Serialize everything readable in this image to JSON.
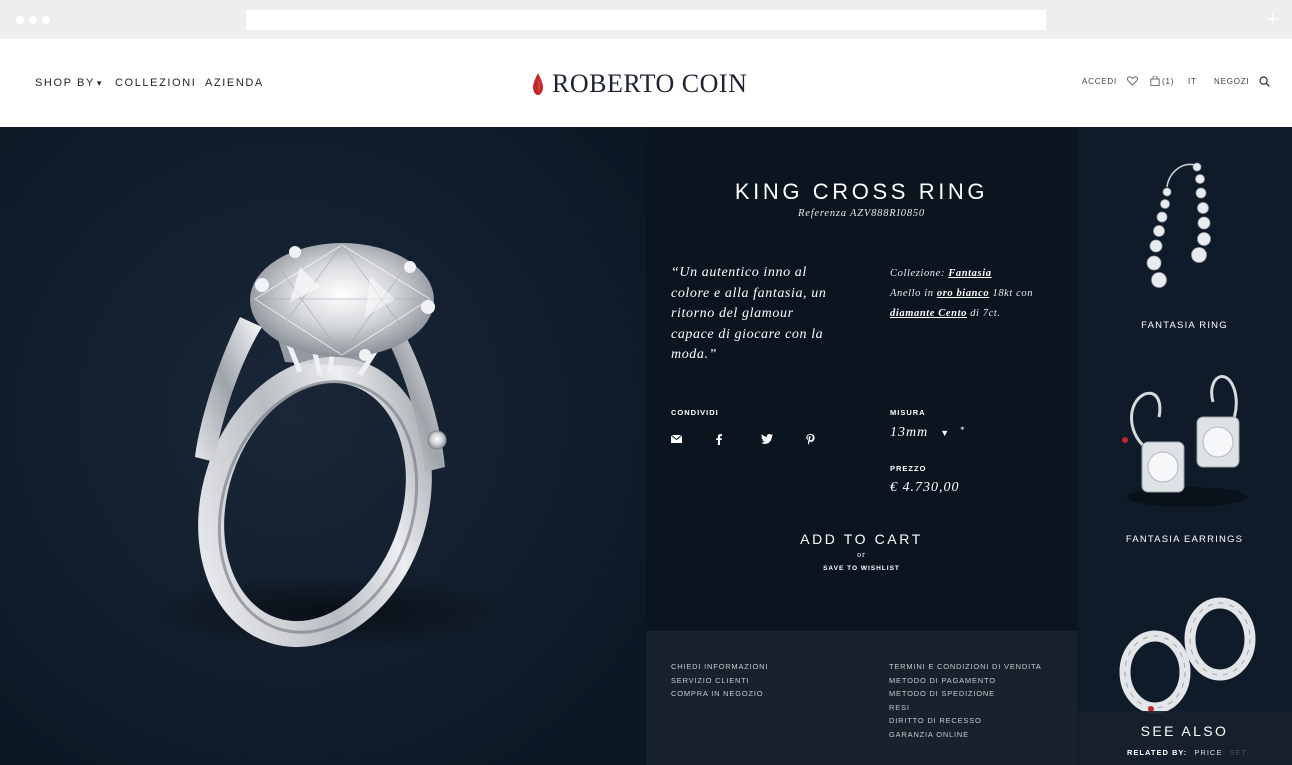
{
  "header": {
    "nav": [
      {
        "label": "SHOP BY"
      },
      {
        "label": "COLLEZIONI"
      },
      {
        "label": "AZIENDA"
      }
    ],
    "logo_text": "ROBERTO COIN",
    "util": {
      "login": "ACCEDI",
      "cart_count": "(1)",
      "language": "IT",
      "stores": "NEGOZI"
    },
    "brand_color": "#c0272d"
  },
  "product": {
    "title": "KING CROSS RING",
    "reference": "Referenza AZV888RI0850",
    "quote": "“Un autentico inno al colore e alla fantasia, un ritorno del glamour capace di giocare con la moda.”",
    "collection_label": "Collezione:",
    "collection_link": "Fantasia",
    "desc_pre": "Anello in",
    "desc_link1": "oro bianco",
    "desc_mid": "18kt con",
    "desc_link2": "diamante Cento",
    "desc_post": "di 7ct.",
    "share_label": "CONDIVIDI",
    "share_icons": [
      "mail-icon",
      "facebook-icon",
      "twitter-icon",
      "pinterest-icon"
    ],
    "size_label": "MISURA",
    "size_value": "13mm",
    "size_required": "*",
    "price_label": "PREZZO",
    "price_value": "€ 4.730,00",
    "add_to_cart": "ADD TO CART",
    "or": "or",
    "wishlist": "SAVE TO WISHLIST"
  },
  "footer": {
    "left": [
      "CHIEDI INFORMAZIONI",
      "SERVIZIO CLIENTI",
      "COMPRA IN NEGOZIO"
    ],
    "right": [
      "TERMINI E CONDIZIONI DI VENDITA",
      "METODO DI PAGAMENTO",
      "METODO DI SPEDIZIONE",
      "RESI",
      "DIRITTO DI RECESSO",
      "GARANZIA ONLINE"
    ]
  },
  "sidebar": {
    "items": [
      {
        "label": "FANTASIA RING"
      },
      {
        "label": "FANTASIA EARRINGS"
      }
    ],
    "see_also": "SEE ALSO",
    "related_by": "RELATED BY:",
    "related_option": "PRICE",
    "related_option2": "SET"
  },
  "colors": {
    "panel_dark": "#0b1520",
    "hero_bg": "#0f1b29",
    "footer_bg": "#18222d"
  }
}
